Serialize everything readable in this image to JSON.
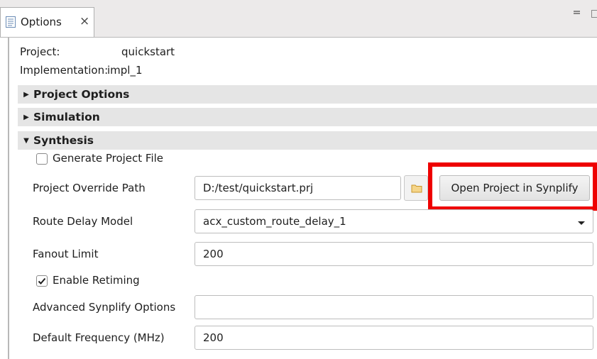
{
  "tab": {
    "label": "Options",
    "close": "×",
    "icon": "list-icon"
  },
  "window_controls": {
    "minimize": "minimize-icon",
    "restore": "restore-icon"
  },
  "info": {
    "project_label": "Project:",
    "project_value": "quickstart",
    "implementation_label": "Implementation:",
    "implementation_value": "impl_1"
  },
  "sections": [
    {
      "label": "Project Options",
      "expanded": false
    },
    {
      "label": "Simulation",
      "expanded": false
    },
    {
      "label": "Synthesis",
      "expanded": true
    }
  ],
  "synthesis": {
    "generate_project_file": {
      "label": "Generate Project File",
      "checked": false
    },
    "project_override_path": {
      "label": "Project Override Path",
      "value": "D:/test/quickstart.prj"
    },
    "open_project_button": "Open Project in Synplify",
    "route_delay_model": {
      "label": "Route Delay Model",
      "value": "acx_custom_route_delay_1"
    },
    "fanout_limit": {
      "label": "Fanout Limit",
      "value": "200"
    },
    "enable_retiming": {
      "label": "Enable Retiming",
      "checked": true
    },
    "advanced_options": {
      "label": "Advanced Synplify Options",
      "value": ""
    },
    "default_frequency": {
      "label": "Default Frequency (MHz)",
      "value": "200"
    }
  },
  "colors": {
    "highlight": "#ee0000",
    "section_bg": "#e5e5e5",
    "folder_icon": "#e8b84a"
  }
}
